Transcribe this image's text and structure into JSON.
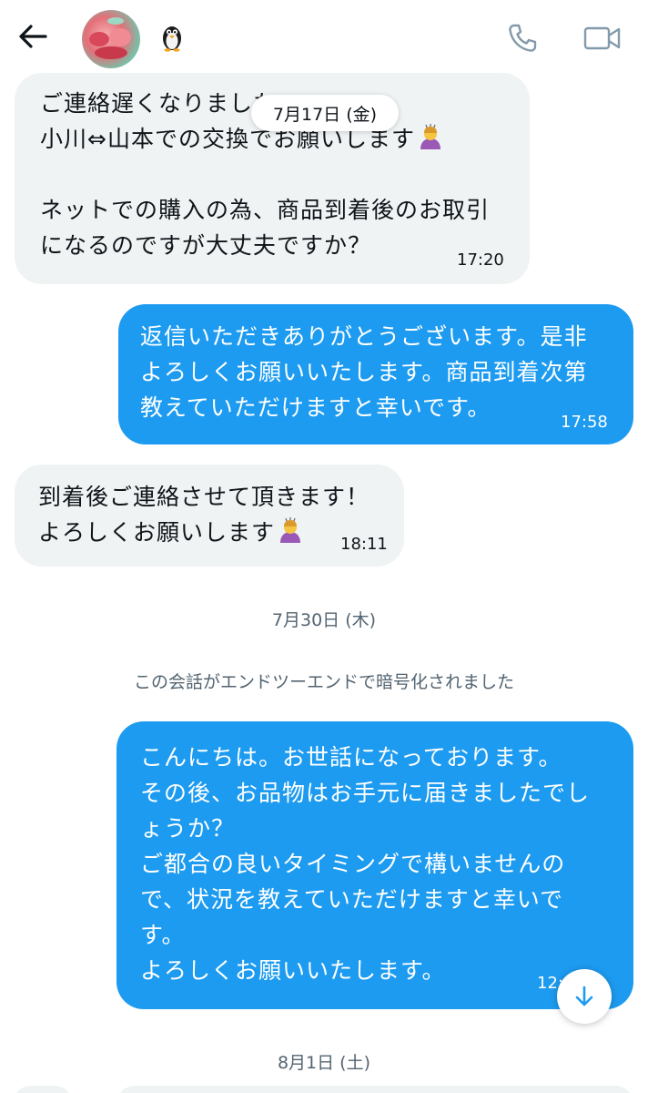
{
  "header": {
    "back_icon": "arrow-left-icon",
    "avatar_alt": "contact avatar",
    "name_emoji": "penguin-emoji",
    "call_icon": "phone-icon",
    "video_icon": "video-camera-icon"
  },
  "sticky_date": "7月17日 (金)",
  "messages": [
    {
      "direction": "in",
      "lines": [
        "ご連絡遅くなりました",
        "小川⇔山本での交換でお願いします",
        "",
        "ネットでの購入の為、商品到着後のお取引",
        "になるのですが大丈夫ですか？"
      ],
      "time": "17:20"
    },
    {
      "direction": "out",
      "lines": [
        "返信いただきありがとうございます。是非",
        "よろしくお願いいたします。商品到着次第",
        "教えていただけますと幸いです。"
      ],
      "time": "17:58"
    },
    {
      "direction": "in",
      "lines": [
        "到着後ご連絡させて頂きます！",
        "よろしくお願いします"
      ],
      "time": "18:11"
    },
    {
      "direction": "out",
      "lines": [
        "こんにちは。お世話になっております。",
        "その後、お品物はお手元に届きましたでし",
        "ょうか？",
        "ご都合の良いタイミングで構いませんの",
        "で、状況を教えていただけますと幸いで",
        "す。",
        "よろしくお願いいたします。"
      ],
      "time": "12:"
    }
  ],
  "date_separators": {
    "jul30": "7月30日 (木)",
    "aug1": "8月1日 (土)"
  },
  "system_note": "この会話がエンドツーエンドで暗号化されました",
  "scroll_button_icon": "arrow-down-icon",
  "colors": {
    "incoming_bubble": "#eff3f4",
    "outgoing_bubble": "#1d9bf0",
    "secondary_text": "#536471"
  }
}
